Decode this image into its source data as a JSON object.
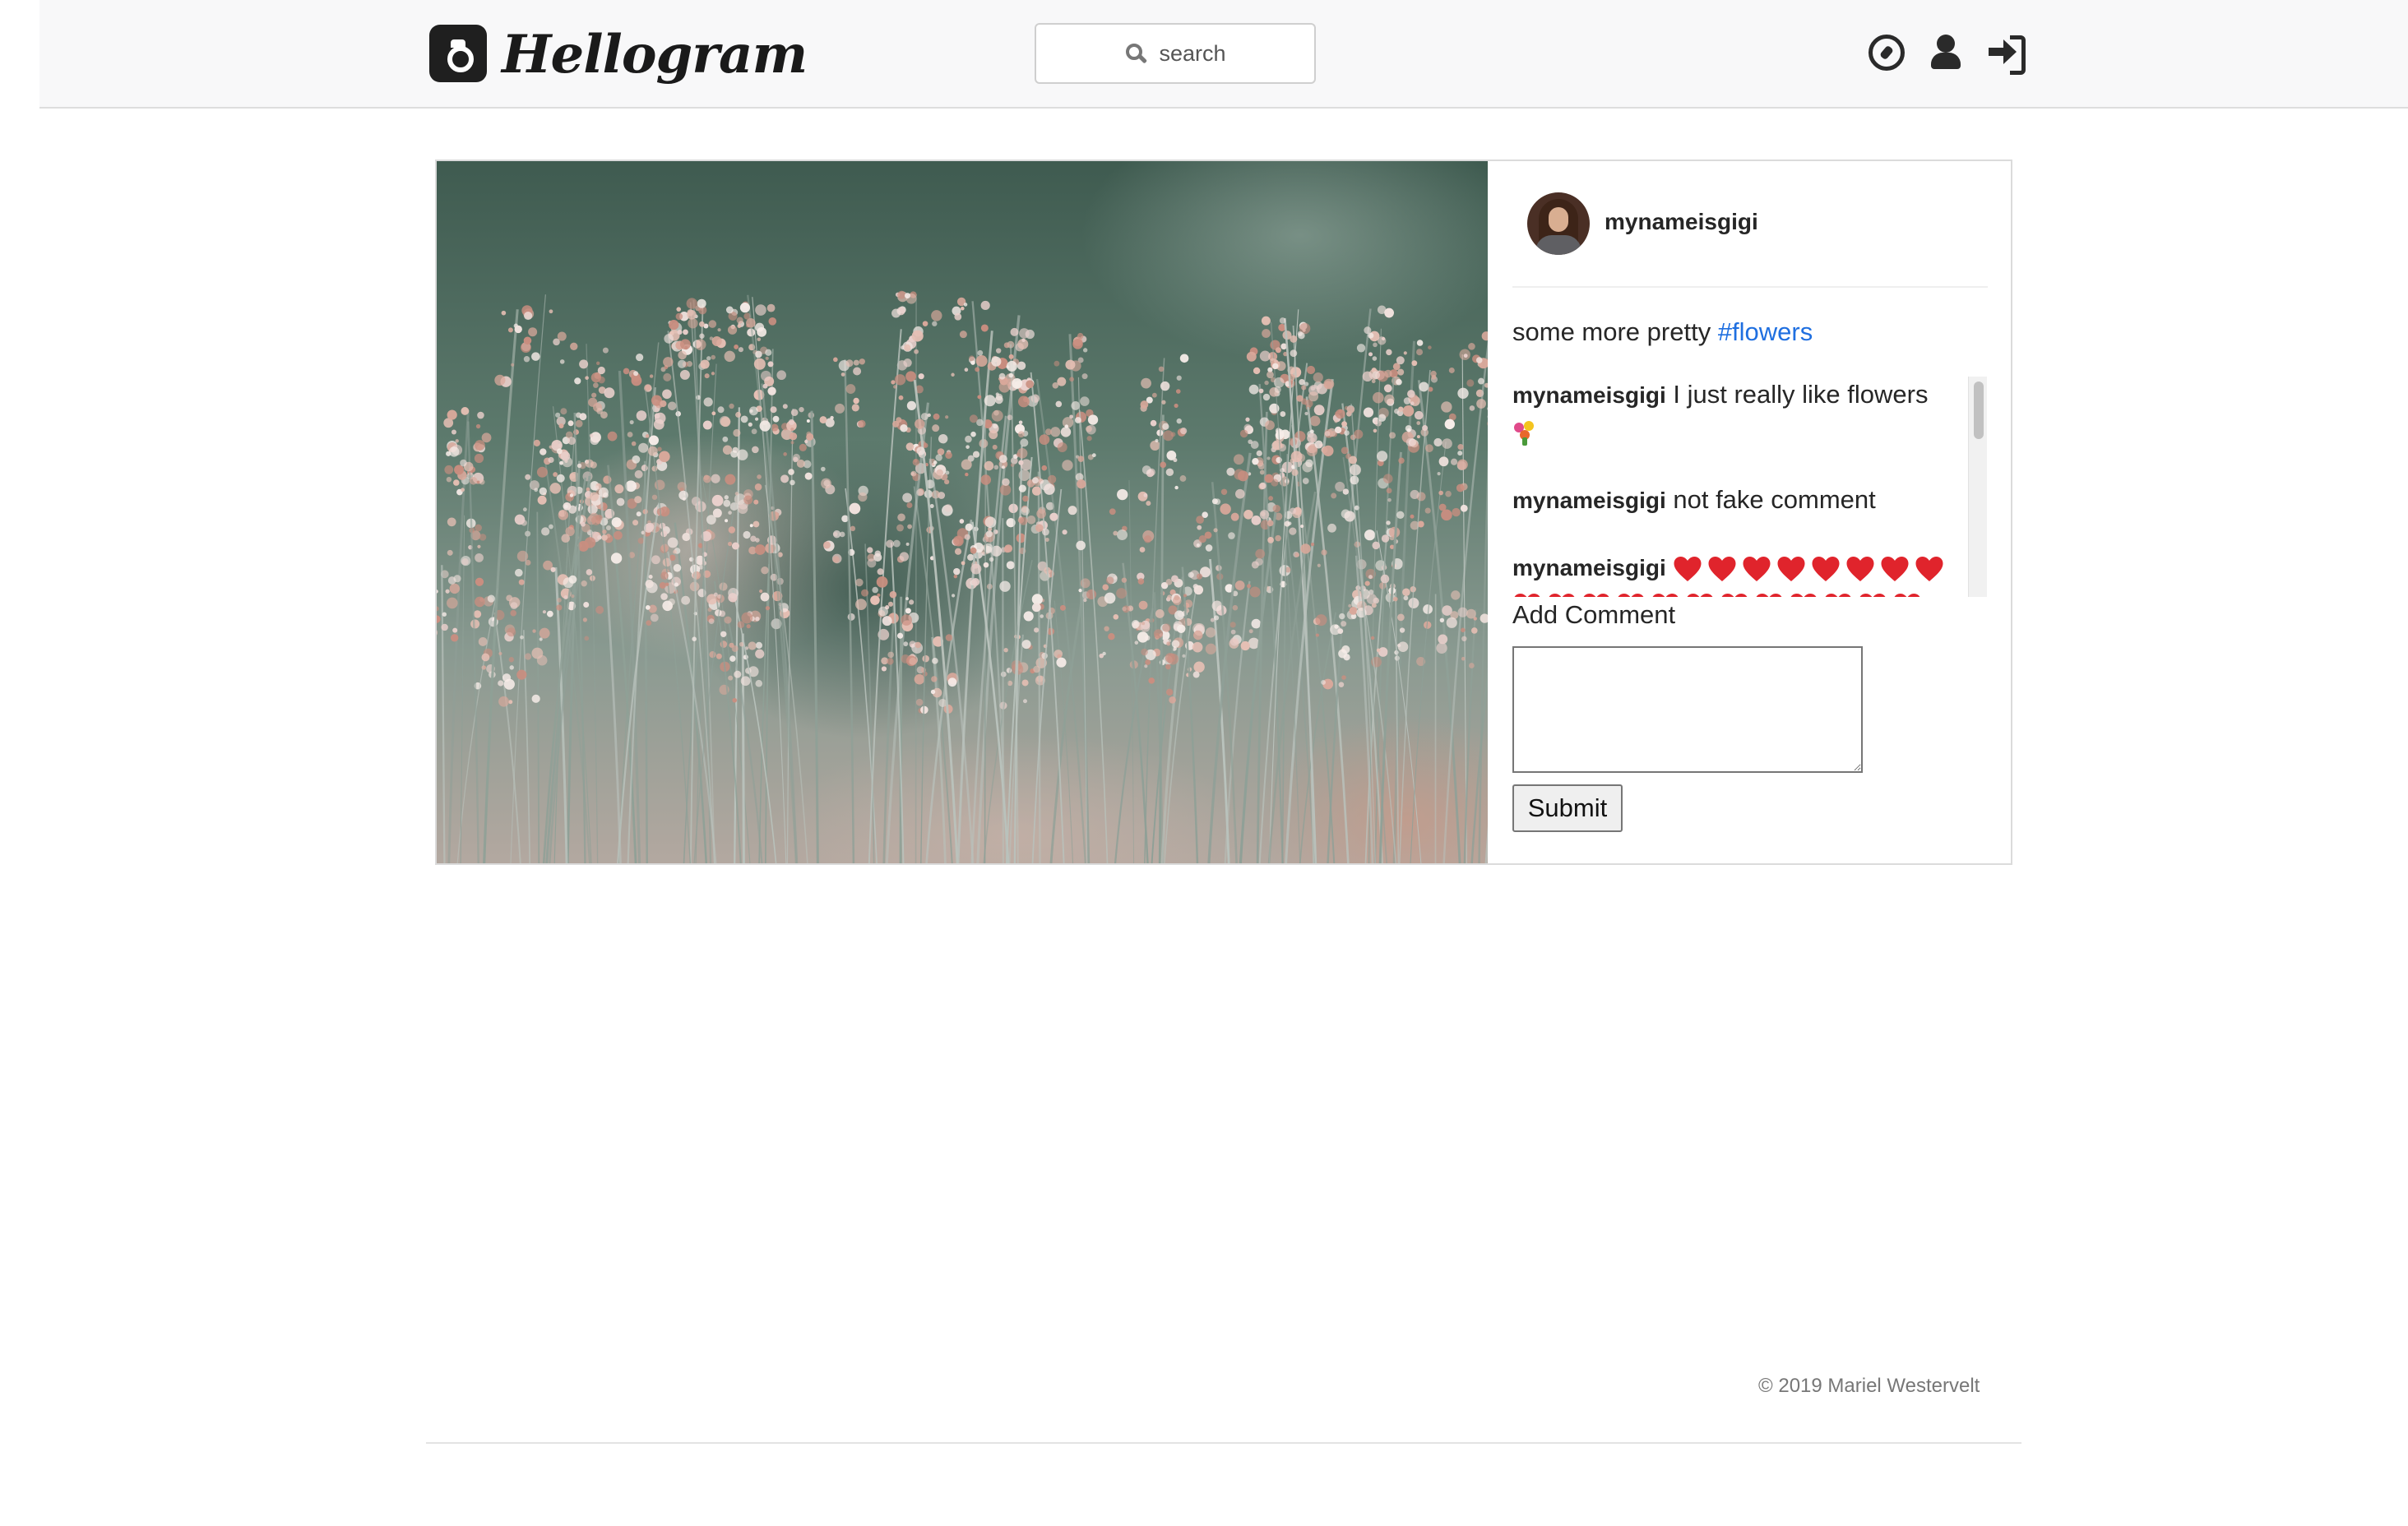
{
  "brand": {
    "name": "Hellogram",
    "logo_icon": "camera-icon"
  },
  "search": {
    "placeholder": "search",
    "icon": "search-icon"
  },
  "nav": {
    "icons": [
      "compass-icon",
      "user-icon",
      "login-icon"
    ]
  },
  "post": {
    "author": "mynameisgigi",
    "caption_text": "some more pretty ",
    "caption_hashtag": "#flowers",
    "comments": [
      {
        "author": "mynameisgigi",
        "text": "I just really like flowers",
        "emoji": "bouquet"
      },
      {
        "author": "mynameisgigi",
        "text": "not fake comment"
      },
      {
        "author": "mynameisgigi",
        "text": "",
        "emoji": "hearts"
      }
    ]
  },
  "comment_form": {
    "label": "Add Comment",
    "value": "",
    "submit_label": "Submit"
  },
  "footer": {
    "text": "© 2019 Mariel Westervelt"
  },
  "colors": {
    "hashtag": "#1f6fe0",
    "navbar_bg": "#f8f8f9",
    "heart": "#e0242c"
  }
}
